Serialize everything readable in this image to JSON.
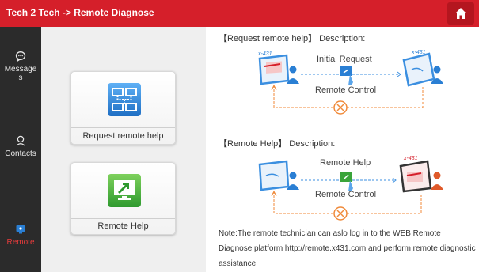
{
  "header": {
    "title": "Tech 2 Tech -> Remote Diagnose",
    "home_label": "home"
  },
  "sidebar": {
    "items": [
      {
        "label": "Messages",
        "icon": "message-icon"
      },
      {
        "label": "Contacts",
        "icon": "contacts-icon"
      },
      {
        "label": "Remote",
        "icon": "remote-icon",
        "active": true
      }
    ]
  },
  "actions": {
    "request": {
      "label": "Request remote help",
      "icon": "network-share-icon",
      "color": "#2a83d6"
    },
    "remote_help": {
      "label": "Remote Help",
      "icon": "screen-arrow-icon",
      "color": "#3aa43a"
    }
  },
  "content": {
    "section1": {
      "title": "【Request remote help】 Description:",
      "top_label": "Initial Request",
      "bottom_label": "Remote Control",
      "device_tag": "x-431"
    },
    "section2": {
      "title": "【Remote Help】 Description:",
      "top_label": "Remote Help",
      "bottom_label": "Remote Control",
      "device_tag": "x-431"
    },
    "note": "Note:The remote technician can aslo log in to the WEB Remote Diagnose platform http://remote.x431.com and perform remote diagnostic assistance"
  },
  "colors": {
    "accent": "#d51f2a",
    "sidebar": "#2b2b2b",
    "dashed_blue": "#3b8fe0",
    "dashed_orange": "#f08a3a"
  }
}
